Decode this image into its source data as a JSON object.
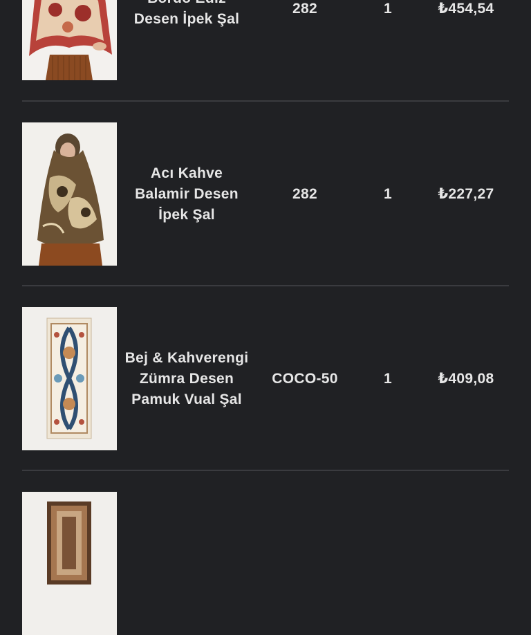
{
  "order_items": [
    {
      "name_lines": [
        "Bordo Ediz",
        "Desen İpek Şal"
      ],
      "code": "282",
      "quantity": "1",
      "price": "₺454,54",
      "image_icon": "scarf-red-paisley-image"
    },
    {
      "name_lines": [
        "Acı Kahve",
        "Balamir Desen",
        "İpek Şal"
      ],
      "code": "282",
      "quantity": "1",
      "price": "₺227,27",
      "image_icon": "scarf-brown-floral-image"
    },
    {
      "name_lines": [
        "Bej & Kahverengi",
        "Zümra Desen",
        "Pamuk Vual Şal"
      ],
      "code": "COCO-50",
      "quantity": "1",
      "price": "₺409,08",
      "image_icon": "scarf-beige-pattern-image"
    },
    {
      "name_lines": [],
      "code": "",
      "quantity": "",
      "price": "",
      "image_icon": "scarf-brown-square-image"
    }
  ],
  "colors": {
    "background": "#202124",
    "text": "#e6e6e6",
    "divider": "#3a3b3f"
  }
}
